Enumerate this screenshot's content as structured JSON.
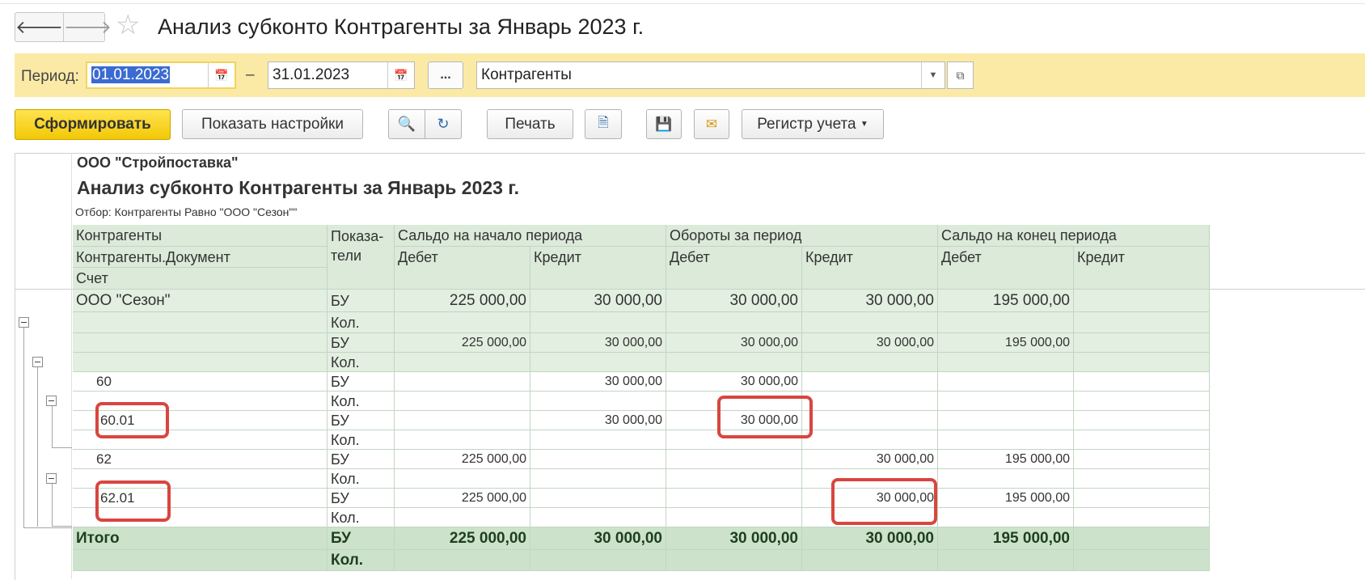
{
  "window": {
    "title": "Анализ субконто Контрагенты за Январь 2023 г."
  },
  "period": {
    "label": "Период:",
    "from": "01.01.2023",
    "separator": "–",
    "to": "31.01.2023",
    "more_label": "...",
    "subconto": "Контрагенты"
  },
  "toolbar": {
    "generate": "Сформировать",
    "settings": "Показать настройки",
    "print": "Печать",
    "register": "Регистр учета"
  },
  "report": {
    "org": "ООО \"Стройпоставка\"",
    "title": "Анализ субконто Контрагенты за Январь 2023 г.",
    "filter": "Отбор: Контрагенты Равно \"ООО \"Сезон\"\"",
    "headers": {
      "col1": [
        "Контрагенты",
        "Контрагенты.Документ",
        "Счет"
      ],
      "indicators": "Показа-\nтели",
      "groups": [
        "Сальдо на начало периода",
        "Обороты за период",
        "Сальдо на конец периода"
      ],
      "sub": [
        "Дебет",
        "Кредит",
        "Дебет",
        "Кредит",
        "Дебет",
        "Кредит"
      ]
    },
    "rows": [
      {
        "name": "ООО \"Сезон\"",
        "ind": "БУ",
        "vals": [
          "225 000,00",
          "30 000,00",
          "30 000,00",
          "30 000,00",
          "195 000,00",
          ""
        ]
      },
      {
        "name": "",
        "ind": "Кол.",
        "vals": [
          "",
          "",
          "",
          "",
          "",
          ""
        ]
      },
      {
        "name": "",
        "ind": "БУ",
        "vals": [
          "225 000,00",
          "30 000,00",
          "30 000,00",
          "30 000,00",
          "195 000,00",
          ""
        ]
      },
      {
        "name": "",
        "ind": "Кол.",
        "vals": [
          "",
          "",
          "",
          "",
          "",
          ""
        ]
      },
      {
        "name": "60",
        "ind": "БУ",
        "vals": [
          "",
          "30 000,00",
          "30 000,00",
          "",
          "",
          ""
        ]
      },
      {
        "name": "",
        "ind": "Кол.",
        "vals": [
          "",
          "",
          "",
          "",
          "",
          ""
        ]
      },
      {
        "name": "60.01",
        "ind": "БУ",
        "vals": [
          "",
          "30 000,00",
          "30 000,00",
          "",
          "",
          ""
        ]
      },
      {
        "name": "",
        "ind": "Кол.",
        "vals": [
          "",
          "",
          "",
          "",
          "",
          ""
        ]
      },
      {
        "name": "62",
        "ind": "БУ",
        "vals": [
          "225 000,00",
          "",
          "",
          "30 000,00",
          "195 000,00",
          ""
        ]
      },
      {
        "name": "",
        "ind": "Кол.",
        "vals": [
          "",
          "",
          "",
          "",
          "",
          ""
        ]
      },
      {
        "name": "62.01",
        "ind": "БУ",
        "vals": [
          "225 000,00",
          "",
          "",
          "30 000,00",
          "195 000,00",
          ""
        ]
      },
      {
        "name": "",
        "ind": "Кол.",
        "vals": [
          "",
          "",
          "",
          "",
          "",
          ""
        ]
      },
      {
        "name": "Итого",
        "ind": "БУ",
        "vals": [
          "225 000,00",
          "30 000,00",
          "30 000,00",
          "30 000,00",
          "195 000,00",
          ""
        ]
      },
      {
        "name": "",
        "ind": "Кол.",
        "vals": [
          "",
          "",
          "",
          "",
          "",
          ""
        ]
      }
    ]
  }
}
